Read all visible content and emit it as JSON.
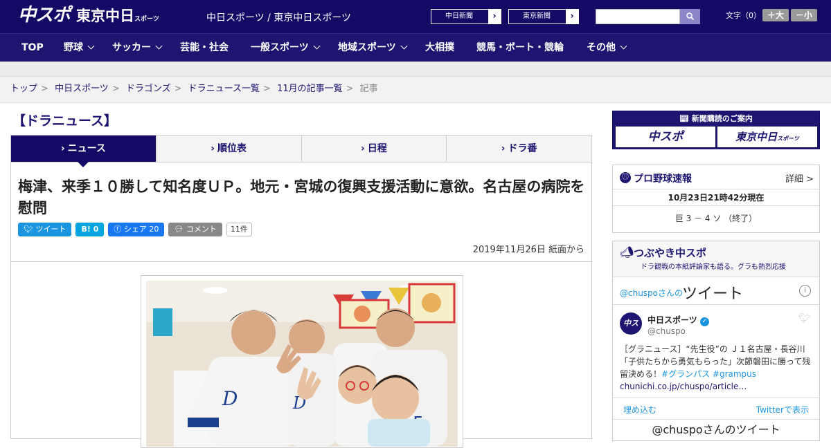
{
  "header": {
    "logo_chuspo": "中スポ",
    "logo_tokyo": "東京中日",
    "logo_tokyo_small": "スポーツ",
    "site_names": "中日スポーツ / 東京中日スポーツ",
    "btn_chunichi": "中日新聞",
    "btn_tokyo": "東京新聞",
    "font_label": "文字（0）",
    "font_big": "＋大",
    "font_small": "－小"
  },
  "nav": {
    "items": [
      "TOP",
      "野球",
      "サッカー",
      "芸能・社会",
      "一般スポーツ",
      "地域スポーツ",
      "大相撲",
      "競馬・ボート・競輪",
      "その他"
    ]
  },
  "breadcrumb": [
    "トップ",
    "中日スポーツ",
    "ドラゴンズ",
    "ドラニュース一覧",
    "11月の記事一覧",
    "記事"
  ],
  "section_title": "【ドラニュース】",
  "tabs": [
    "ニュース",
    "順位表",
    "日程",
    "ドラ番"
  ],
  "article": {
    "headline": "梅津、来季１０勝して知名度ＵＰ。地元・宮城の復興支援活動に意欲。名古屋の病院を慰問",
    "tweet_btn": "ツイート",
    "hatena_btn": "B! 0",
    "share_btn": "シェア 20",
    "comment_btn": "コメント",
    "comment_count": "11件",
    "date": "2019年11月26日 紙面から"
  },
  "sidebar": {
    "ad_title": "新聞購読のご案内",
    "ad_chuspo": "中スポ",
    "ad_tokyo": "東京中日",
    "ad_tokyo_small": "スポーツ",
    "baseball_title": "プロ野球速報",
    "baseball_more": "詳細 >",
    "baseball_time": "10月23日21時42分現在",
    "baseball_score": "巨 3 － 4 ソ （終了）",
    "tsubuyaki_title": "つぶやき中スポ",
    "tsubuyaki_sub": "ドラ観戦の本紙評論家も語る。グラも熱烈応援",
    "tw_user_prefix": "@chuspoさんの",
    "tw_title": "ツイート",
    "tweet_name": "中日スポーツ",
    "tweet_handle": "@chuspo",
    "tweet_text": "［グラニュース］“先生役”の Ｊ１名古屋・長谷川「子供たちから勇気もらった」次節磐田に勝って残留決める！",
    "tweet_hash1": "#グランパス",
    "tweet_hash2": "#grampus",
    "tweet_link": "chunichi.co.jp/chuspo/article…",
    "embed": "埋め込む",
    "view_twitter": "Twitterで表示",
    "more_title": "@chuspoさんのツイート"
  },
  "colors": {
    "brand_navy": "#140a66",
    "nav_bg": "#1d1570",
    "twitter_blue": "#1b95e0"
  }
}
